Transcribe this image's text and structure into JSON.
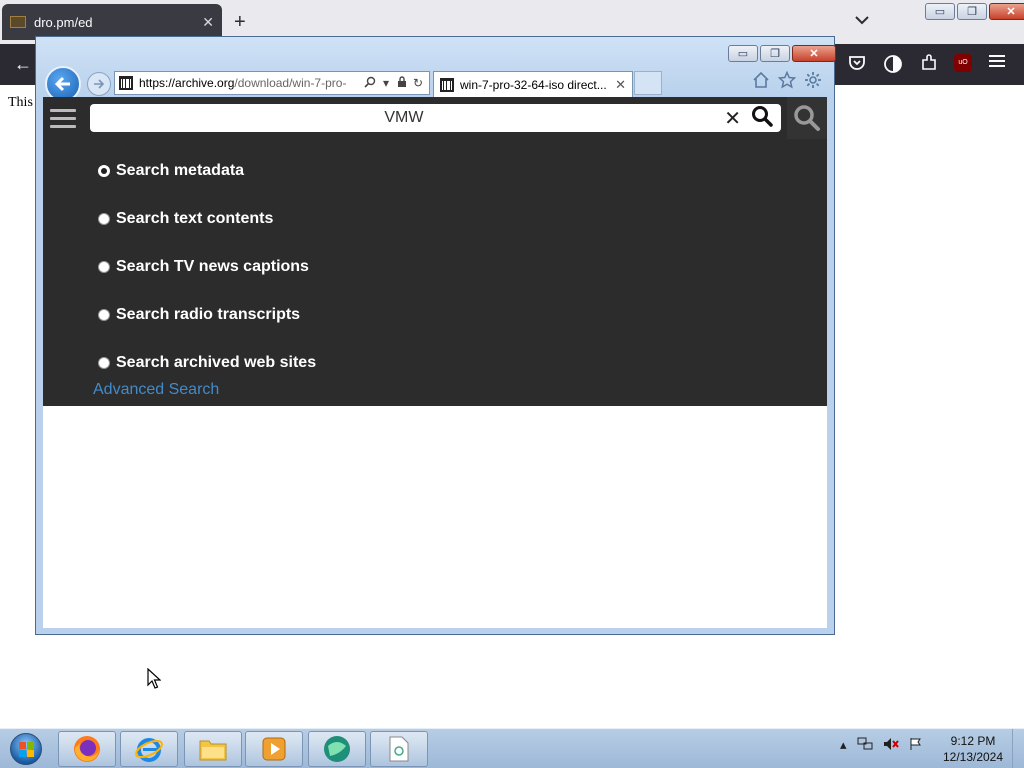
{
  "browser_bg": {
    "tab_title": "dro.pm/ed",
    "tab_close": "✕",
    "new_tab": "+",
    "list_tabs": "⌄",
    "back": "←",
    "page_text": "This"
  },
  "window_controls": {
    "minimize": "▭",
    "restore": "❐",
    "close": "✕"
  },
  "ie": {
    "address_url_host": "https://archive.org",
    "address_url_path": "/download/win-7-pro-",
    "tab_title": "win-7-pro-32-64-iso direct...",
    "tab_close": "✕"
  },
  "archive": {
    "search_value": "VMW ",
    "search_clear": "✕",
    "options": [
      {
        "label": "Search metadata",
        "selected": true
      },
      {
        "label": "Search text contents",
        "selected": false
      },
      {
        "label": "Search TV news captions",
        "selected": false
      },
      {
        "label": "Search radio transcripts",
        "selected": false
      },
      {
        "label": "Search archived web sites",
        "selected": false
      }
    ],
    "advanced_search": "Advanced Search",
    "link_color": "#428bca",
    "header_color": "#2c2c2c"
  },
  "taskbar": {
    "time": "9:12 PM",
    "date": "12/13/2024",
    "apps": [
      "firefox-icon",
      "internet-explorer-icon",
      "file-explorer-icon",
      "media-player-icon",
      "app-globe-icon",
      "document-icon"
    ]
  }
}
